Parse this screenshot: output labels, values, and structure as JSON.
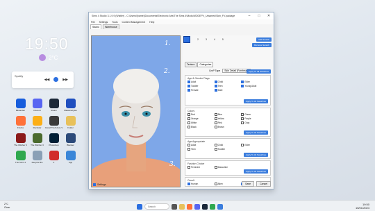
{
  "desktop": {
    "clock": "19:50",
    "weather": {
      "temp": "2°C",
      "icon": "cloud-moon-icon"
    },
    "media_widget": {
      "label": "Spotify"
    },
    "icons": [
      {
        "label": "Bitwarden",
        "color": "#175ddc"
      },
      {
        "label": "Discord",
        "color": "#5865f2"
      },
      {
        "label": "Steam",
        "color": "#1b2838"
      },
      {
        "label": "Malwarebytes",
        "color": "#1f4fbf"
      },
      {
        "label": "Firefox",
        "color": "#ff7139"
      },
      {
        "label": "Rockstar",
        "color": "#fcaf17"
      },
      {
        "label": "Grand Theft Auto V",
        "color": "#3a3a3a"
      },
      {
        "label": "Folder",
        "color": "#e8c15b"
      },
      {
        "label": "The Witcher 3",
        "color": "#8b1a1a"
      },
      {
        "label": "The Witcher 3",
        "color": "#4b6b2f"
      },
      {
        "label": "Photoshop",
        "color": "#001e36"
      },
      {
        "label": "Blender",
        "color": "#2c4a7a"
      },
      {
        "label": "The Sims 4",
        "color": "#2fa84f"
      },
      {
        "label": "Recycle Bin",
        "color": "#8aa0b6"
      },
      {
        "label": "2",
        "color": "#d12b2b"
      },
      {
        "label": "App",
        "color": "#3a86d8"
      }
    ]
  },
  "window": {
    "title": "Sims 4 Studio 3.1.9.9 (Wistler) - C:\\Users\\[name]\\Documents\\Electronic Arts\\The Sims 4\\Mods\\MODEPV_Untamed\\Skin_FV.package",
    "menu": [
      "File",
      "Settings",
      "Tools",
      "Content Management",
      "Help"
    ],
    "tabs": [
      "Studio",
      "Warehouse"
    ],
    "swatch_labels": [
      "1",
      "2",
      "3",
      "4",
      "5"
    ],
    "buttons": {
      "add_swatch": "Add Swatch",
      "remove_swatch": "Remove Swatch",
      "set_skintone": "Apply To All Swatches",
      "apply_all": "Apply To All Swatches"
    },
    "subtabs": [
      "Texture",
      "Categories"
    ],
    "cmp_type_label": "CmP Type",
    "cmp_type_value": "Skin Detail (Forehead)",
    "age_gender": {
      "title": "Age & Gender Flags",
      "items": [
        {
          "label": "Adult",
          "checked": true
        },
        {
          "label": "Child",
          "checked": true
        },
        {
          "label": "Elder",
          "checked": true
        },
        {
          "label": "Toddler",
          "checked": true
        },
        {
          "label": "Teen",
          "checked": true
        },
        {
          "label": "Young Adult",
          "checked": true
        },
        {
          "label": "Female",
          "checked": true
        },
        {
          "label": "Male",
          "checked": true
        }
      ]
    },
    "colors": {
      "title": "Colors",
      "items": [
        "Red",
        "Blue",
        "Green",
        "Orange",
        "Yellow",
        "Purple",
        "White",
        "Pink",
        "Gray",
        "Black",
        "Brown"
      ]
    },
    "age_appropriate": {
      "title": "Age Appropriate",
      "items": [
        "Adult",
        "Child",
        "Elder",
        "Teen",
        "Toddler"
      ]
    },
    "fashion": {
      "title": "Fashion Choice",
      "items": [
        "Feminine",
        "Masculine"
      ]
    },
    "occult": {
      "title": "Occult",
      "items": [
        {
          "label": "Human",
          "checked": true
        },
        {
          "label": "Alien",
          "checked": false
        },
        {
          "label": "Mermaid",
          "checked": true
        },
        {
          "label": "Vampire",
          "checked": true
        },
        {
          "label": "Spellcaster",
          "checked": true
        },
        {
          "label": "Werewolf",
          "checked": false
        }
      ]
    },
    "settings_label": "Settings",
    "save": "Save",
    "cancel": "Cancel"
  },
  "annotations": [
    "1.",
    "2.",
    "3."
  ],
  "taskbar": {
    "weather_temp": "2°C",
    "weather_desc": "Clear",
    "search_placeholder": "Search",
    "time": "19:50",
    "date": "15/01/2024"
  }
}
